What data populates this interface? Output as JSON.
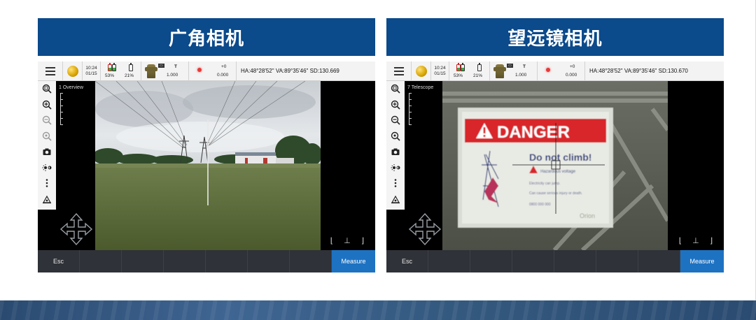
{
  "panels": [
    {
      "title": "广角相机",
      "status": {
        "time": "10:24",
        "date": "01/15",
        "battery1": "53%",
        "battery2": "21%",
        "target_label": "T",
        "target_value": "1.000",
        "laser_label": "+0",
        "laser_value": "0.000",
        "angles": "HA:48°28'52\"  VA:89°35'46\"  SD:130.669"
      },
      "view_label": "1 Overview",
      "softkeys": {
        "esc": "Esc",
        "measure": "Measure"
      }
    },
    {
      "title": "望远镜相机",
      "status": {
        "time": "10:24",
        "date": "01/15",
        "battery1": "53%",
        "battery2": "21%",
        "target_label": "T",
        "target_value": "1.000",
        "laser_label": "+0",
        "laser_value": "0.000",
        "angles": "HA:48°28'52\"  VA:89°35'46\"  SD:130.670"
      },
      "view_label": "7 Telescope",
      "sign": {
        "warning": "DANGER",
        "line1": "Do not climb!",
        "line2": "Hazardous voltage",
        "line3": "Electricity can jump.",
        "line4": "Can cause serious injury or death.",
        "line5": "0800 000 000",
        "logo": "Orion"
      },
      "softkeys": {
        "esc": "Esc",
        "measure": "Measure"
      }
    }
  ],
  "icons": [
    "menu-icon",
    "globe-icon",
    "battery-icon",
    "prism-icon",
    "laser-icon",
    "zoom-fit-icon",
    "zoom-in-icon",
    "zoom-out-icon",
    "zoom-reset-icon",
    "camera-icon",
    "brightness-icon",
    "more-icon",
    "level-icon",
    "nav-pad-icon"
  ],
  "colors": {
    "banner": "#0b4a8b",
    "measure": "#1e72c2",
    "softkey_bar": "#2f3238",
    "danger_red": "#d8262b"
  }
}
